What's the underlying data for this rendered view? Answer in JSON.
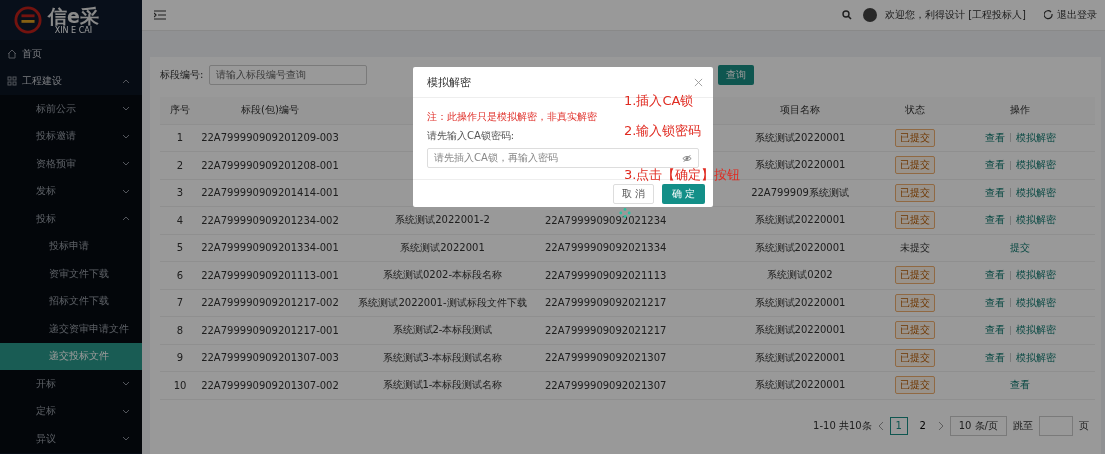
{
  "logo": {
    "text": "信e采",
    "subtitle": "XIN E CAI"
  },
  "sidebar": {
    "items": [
      {
        "label": "首页"
      },
      {
        "label": "工程建设",
        "expanded": true,
        "children": [
          {
            "label": "标前公示",
            "expanded": false
          },
          {
            "label": "投标邀请",
            "expanded": false
          },
          {
            "label": "资格预审",
            "expanded": false
          },
          {
            "label": "发标",
            "expanded": false
          },
          {
            "label": "投标",
            "expanded": true,
            "children": [
              {
                "label": "投标申请",
                "selected": false
              },
              {
                "label": "资审文件下载",
                "selected": false
              },
              {
                "label": "招标文件下载",
                "selected": false
              },
              {
                "label": "递交资审申请文件",
                "selected": false
              },
              {
                "label": "递交投标文件",
                "selected": true
              }
            ]
          },
          {
            "label": "开标",
            "expanded": false
          },
          {
            "label": "定标",
            "expanded": false
          },
          {
            "label": "异议",
            "expanded": false
          }
        ]
      }
    ]
  },
  "header": {
    "welcome": "欢迎您，利得设计 [工程投标人]",
    "logout": "退出登录"
  },
  "filter": {
    "label": "标段编号:",
    "placeholder": "请输入标段编号查询",
    "button": "查询"
  },
  "table": {
    "columns": [
      "序号",
      "标段(包)编号",
      null,
      null,
      "项目名称",
      "状态",
      "操作"
    ],
    "rows": [
      {
        "cells": [
          "1",
          "22A799990909201209-003",
          null,
          null,
          "系统测试20220001"
        ],
        "status": {
          "text": "已提交",
          "kind": "tag"
        },
        "actions": [
          "查看",
          "模拟解密"
        ]
      },
      {
        "cells": [
          "2",
          "22A799990909201208-001",
          null,
          null,
          "系统测试20220001"
        ],
        "status": {
          "text": "已提交",
          "kind": "tag"
        },
        "actions": [
          "查看",
          "模拟解密"
        ]
      },
      {
        "cells": [
          "3",
          "22A799990909201414-001",
          null,
          null,
          "22A799909系统测试"
        ],
        "status": {
          "text": "已提交",
          "kind": "tag"
        },
        "actions": [
          "查看",
          "模拟解密"
        ]
      },
      {
        "cells": [
          "4",
          "22A799990909201234-002",
          "系统测试2022001-2",
          "22A7999909092021234",
          "系统测试20220001"
        ],
        "status": {
          "text": "已提交",
          "kind": "tag"
        },
        "actions": [
          "查看",
          "模拟解密"
        ]
      },
      {
        "cells": [
          "5",
          "22A799990909201334-001",
          "系统测试2022001",
          "22A7999909092021334",
          "系统测试20220001"
        ],
        "status": {
          "text": "未提交",
          "kind": "plain"
        },
        "actions": [
          "提交"
        ]
      },
      {
        "cells": [
          "6",
          "22A799990909201113-001",
          "系统测试0202-本标段名称",
          "22A7999909092021113",
          "系统测试0202"
        ],
        "status": {
          "text": "已提交",
          "kind": "tag"
        },
        "actions": [
          "查看",
          "模拟解密"
        ]
      },
      {
        "cells": [
          "7",
          "22A799990909201217-002",
          "系统测试2022001-测试标段文件下载",
          "22A7999909092021217",
          "系统测试20220001"
        ],
        "status": {
          "text": "已提交",
          "kind": "tag"
        },
        "actions": [
          "查看",
          "模拟解密"
        ]
      },
      {
        "cells": [
          "8",
          "22A799990909201217-001",
          "系统测试2-本标段测试",
          "22A7999909092021217",
          "系统测试20220001"
        ],
        "status": {
          "text": "已提交",
          "kind": "tag"
        },
        "actions": [
          "查看",
          "模拟解密"
        ]
      },
      {
        "cells": [
          "9",
          "22A799990909201307-003",
          "系统测试3-本标段测试名称",
          "22A7999909092021307",
          "系统测试20220001"
        ],
        "status": {
          "text": "已提交",
          "kind": "tag"
        },
        "actions": [
          "查看",
          "模拟解密"
        ]
      },
      {
        "cells": [
          "10",
          "22A799990909201307-002",
          "系统测试1-本标段测试名称",
          "22A7999909092021307",
          "系统测试20220001"
        ],
        "status": {
          "text": "已提交",
          "kind": "tag"
        },
        "actions": [
          "查看"
        ]
      }
    ]
  },
  "pagination": {
    "summary": "1-10 共10条",
    "pages": [
      {
        "label": "1",
        "selected": true
      },
      {
        "label": "2",
        "selected": false
      }
    ],
    "size": "10 条/页",
    "jump": "跳至",
    "unit": "页"
  },
  "dialog": {
    "title": "模拟解密",
    "note": "注：此操作只是模拟解密，非真实解密",
    "label": "请先输入CA锁密码:",
    "placeholder": "请先插入CA锁，再输入密码",
    "cancel": "取 消",
    "confirm": "确 定",
    "annotations": [
      "1.插入CA锁",
      "2.输入锁密码",
      "3.点击【确定】按钮"
    ]
  }
}
